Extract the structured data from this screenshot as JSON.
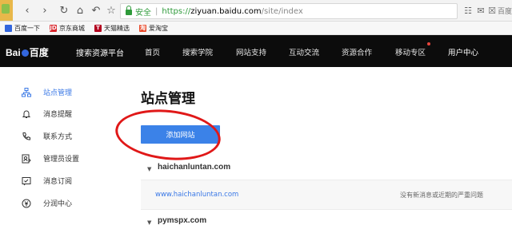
{
  "browser": {
    "secure_label": "安全",
    "url_scheme": "https://",
    "url_host": "ziyuan.baidu.com",
    "url_path": "/site/index",
    "right_text": "百度",
    "bookmarks": [
      {
        "label": "百度一下",
        "color": "#3366dd",
        "glyph": ""
      },
      {
        "label": "京东商城",
        "color": "#d9262c",
        "glyph": "JD"
      },
      {
        "label": "天猫精选",
        "color": "#b3001e",
        "glyph": "T"
      },
      {
        "label": "爱淘宝",
        "color": "#e94b2c",
        "glyph": "淘"
      }
    ]
  },
  "header": {
    "logo_text_left": "Bai",
    "logo_text_right": "百度",
    "platform": "搜索资源平台",
    "nav": [
      "首页",
      "搜索学院",
      "网站支持",
      "互动交流",
      "资源合作",
      "移动专区"
    ],
    "user_center": "用户中心"
  },
  "sidebar": {
    "items": [
      {
        "label": "站点管理",
        "icon": "sitemap-icon",
        "active": true
      },
      {
        "label": "消息提醒",
        "icon": "bell-icon",
        "active": false
      },
      {
        "label": "联系方式",
        "icon": "phone-icon",
        "active": false
      },
      {
        "label": "管理员设置",
        "icon": "admin-icon",
        "active": false
      },
      {
        "label": "消息订阅",
        "icon": "subscribe-icon",
        "active": false
      },
      {
        "label": "分润中心",
        "icon": "revenue-icon",
        "active": false
      }
    ],
    "accent": "#3a78e6"
  },
  "main": {
    "title": "站点管理",
    "add_button": "添加网站",
    "sites": [
      {
        "name": "haichanluntan.com",
        "link": "www.haichanluntan.com",
        "status": "没有新消息或近期的严重问题"
      },
      {
        "name": "pymspx.com"
      }
    ]
  }
}
